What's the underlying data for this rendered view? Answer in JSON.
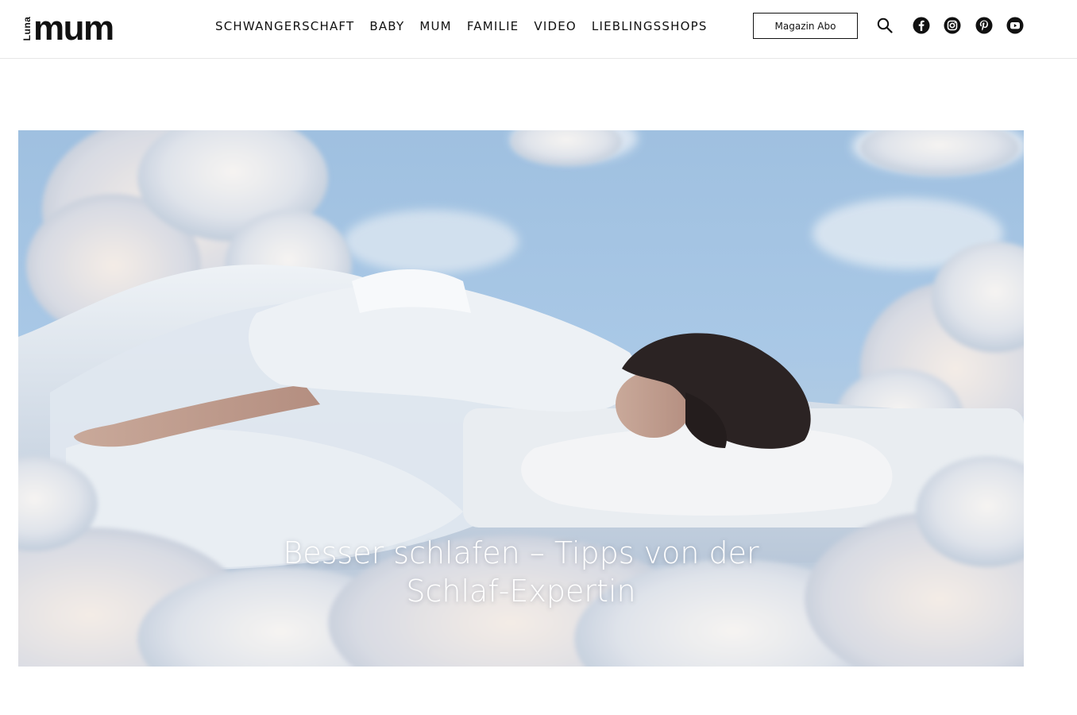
{
  "brand": {
    "logo_small": "Luna",
    "logo_main": "mum"
  },
  "nav": {
    "items": [
      {
        "label": "SCHWANGERSCHAFT"
      },
      {
        "label": "BABY"
      },
      {
        "label": "MUM"
      },
      {
        "label": "FAMILIE"
      },
      {
        "label": "VIDEO"
      },
      {
        "label": "LIEBLINGSSHOPS"
      }
    ]
  },
  "header_actions": {
    "abo_label": "Magazin Abo",
    "search_icon": "search-icon",
    "social": [
      {
        "icon": "facebook-icon"
      },
      {
        "icon": "instagram-icon"
      },
      {
        "icon": "pinterest-icon"
      },
      {
        "icon": "youtube-icon"
      }
    ]
  },
  "hero": {
    "title_line1": "Besser schlafen – Tipps von der",
    "title_line2": "Schlaf-Expertin",
    "image": "woman sleeping on bed among clouds"
  },
  "colors": {
    "text": "#111111",
    "sky": "#a9c8e6",
    "hero_text": "#ffffff"
  }
}
